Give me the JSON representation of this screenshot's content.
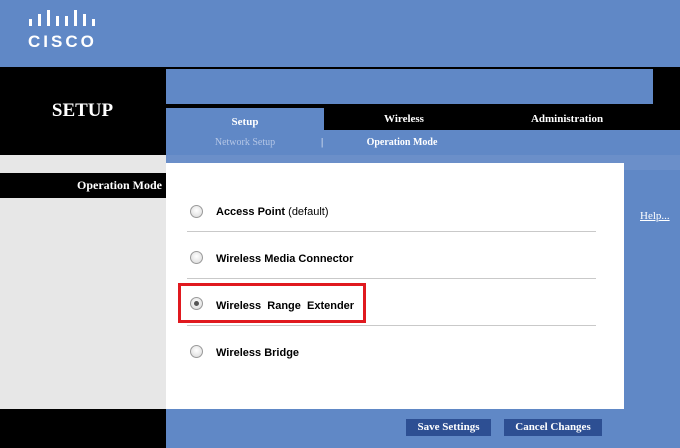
{
  "brand": {
    "logo_text": "CISCO"
  },
  "page": {
    "title": "SETUP"
  },
  "tabs": [
    {
      "label": "Setup",
      "active": true
    },
    {
      "label": "Wireless",
      "active": false
    },
    {
      "label": "Administration",
      "active": false
    }
  ],
  "subnav": {
    "items": [
      "Network Setup",
      "Operation Mode"
    ],
    "separator": "|",
    "active": "Operation Mode"
  },
  "section": {
    "label": "Operation Mode",
    "help_link": "Help..."
  },
  "options": [
    {
      "label": "Access Point",
      "note": "(default)",
      "selected": false
    },
    {
      "label": "Wireless Media Connector",
      "note": "",
      "selected": false
    },
    {
      "label": "Wireless  Range  Extender",
      "note": "",
      "selected": true
    },
    {
      "label": "Wireless Bridge",
      "note": "",
      "selected": false
    }
  ],
  "buttons": {
    "save": "Save Settings",
    "cancel": "Cancel Changes"
  },
  "colors": {
    "header_blue": "#6088c6",
    "button_blue": "#2d4f93",
    "highlight_red": "#e0191f"
  }
}
